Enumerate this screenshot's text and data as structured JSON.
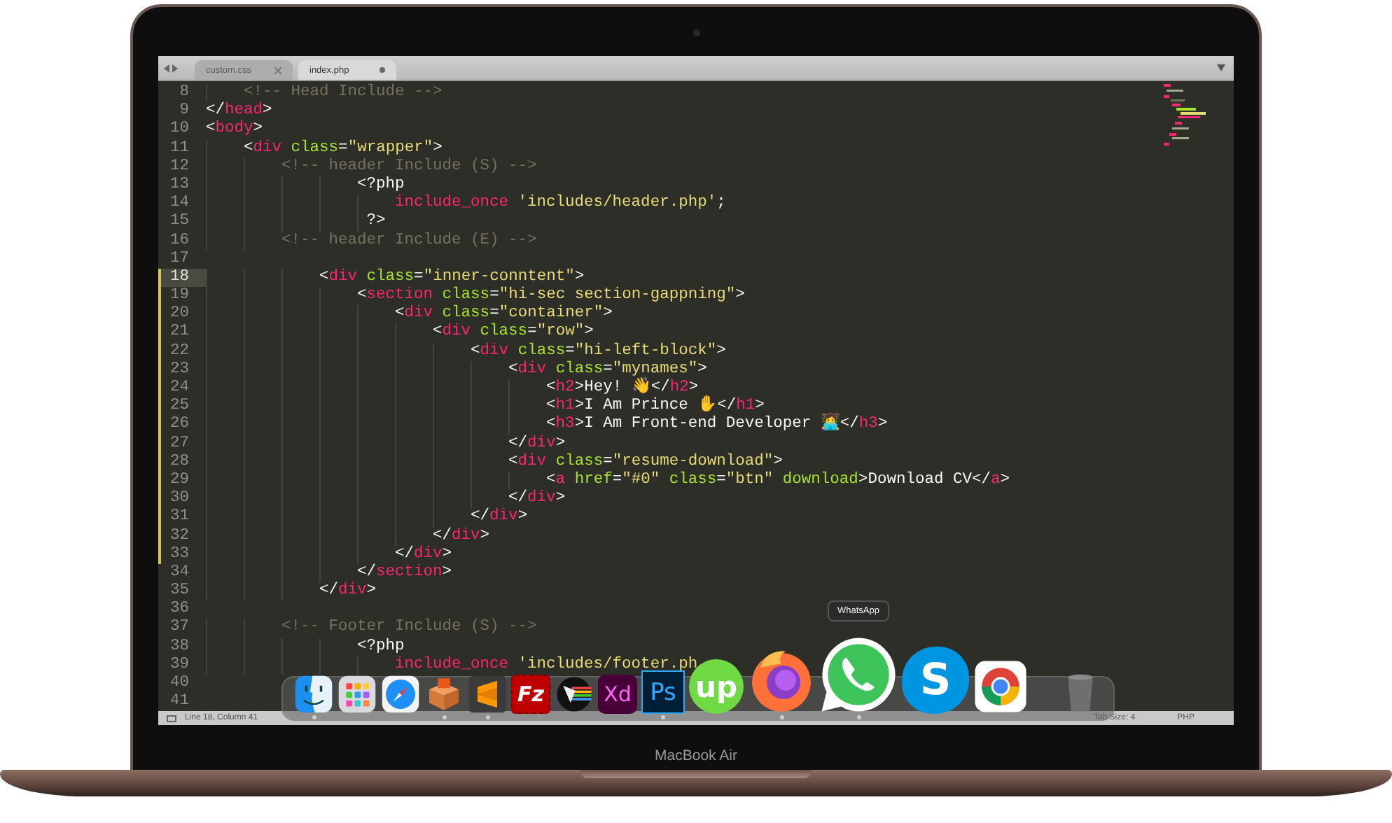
{
  "editor": {
    "tabs": [
      {
        "label": "custom.css",
        "selected": false,
        "modified": false
      },
      {
        "label": "index.php",
        "selected": true,
        "modified": true
      }
    ],
    "lines": [
      {
        "number": "8",
        "current": false,
        "changed": false,
        "tokens": [
          {
            "kind": "comment",
            "text": "    <!-- Head Include -->"
          }
        ]
      },
      {
        "number": "9",
        "current": false,
        "changed": false,
        "tokens": [
          {
            "kind": "punct",
            "text": "</"
          },
          {
            "kind": "tag",
            "text": "head"
          },
          {
            "kind": "punct",
            "text": ">"
          }
        ]
      },
      {
        "number": "10",
        "current": false,
        "changed": false,
        "tokens": [
          {
            "kind": "punct",
            "text": "<"
          },
          {
            "kind": "tag",
            "text": "body"
          },
          {
            "kind": "punct",
            "text": ">"
          }
        ]
      },
      {
        "number": "11",
        "current": false,
        "changed": false,
        "tokens": [
          {
            "kind": "punct",
            "text": "    <"
          },
          {
            "kind": "tag",
            "text": "div"
          },
          {
            "kind": "attr",
            "text": " class"
          },
          {
            "kind": "punct",
            "text": "="
          },
          {
            "kind": "string",
            "text": "\"wrapper\""
          },
          {
            "kind": "punct",
            "text": ">"
          }
        ]
      },
      {
        "number": "12",
        "current": false,
        "changed": false,
        "tokens": [
          {
            "kind": "comment",
            "text": "        <!-- header Include (S) -->"
          }
        ]
      },
      {
        "number": "13",
        "current": false,
        "changed": false,
        "tokens": [
          {
            "kind": "punct",
            "text": "                <?php"
          }
        ]
      },
      {
        "number": "14",
        "current": false,
        "changed": false,
        "tokens": [
          {
            "kind": "keyword",
            "text": "                    include_once"
          },
          {
            "kind": "string",
            "text": " 'includes/header.php'"
          },
          {
            "kind": "punct",
            "text": ";"
          }
        ]
      },
      {
        "number": "15",
        "current": false,
        "changed": false,
        "tokens": [
          {
            "kind": "punct",
            "text": "                 ?>"
          }
        ]
      },
      {
        "number": "16",
        "current": false,
        "changed": false,
        "tokens": [
          {
            "kind": "comment",
            "text": "        <!-- header Include (E) -->"
          }
        ]
      },
      {
        "number": "17",
        "current": false,
        "changed": false
      },
      {
        "number": "18",
        "current": true,
        "changed": true,
        "tokens": [
          {
            "kind": "punct",
            "text": "            <"
          },
          {
            "kind": "tag",
            "text": "div"
          },
          {
            "kind": "attr",
            "text": " class"
          },
          {
            "kind": "punct",
            "text": "="
          },
          {
            "kind": "string",
            "text": "\"inner-conntent\""
          },
          {
            "kind": "punct",
            "text": ">"
          }
        ]
      },
      {
        "number": "19",
        "current": false,
        "changed": true,
        "tokens": [
          {
            "kind": "punct",
            "text": "                <"
          },
          {
            "kind": "tag",
            "text": "section"
          },
          {
            "kind": "attr",
            "text": " class"
          },
          {
            "kind": "punct",
            "text": "="
          },
          {
            "kind": "string",
            "text": "\"hi-sec section-gappning\""
          },
          {
            "kind": "punct",
            "text": ">"
          }
        ]
      },
      {
        "number": "20",
        "current": false,
        "changed": true,
        "tokens": [
          {
            "kind": "punct",
            "text": "                    <"
          },
          {
            "kind": "tag",
            "text": "div"
          },
          {
            "kind": "attr",
            "text": " class"
          },
          {
            "kind": "punct",
            "text": "="
          },
          {
            "kind": "string",
            "text": "\"container\""
          },
          {
            "kind": "punct",
            "text": ">"
          }
        ]
      },
      {
        "number": "21",
        "current": false,
        "changed": true,
        "tokens": [
          {
            "kind": "punct",
            "text": "                        <"
          },
          {
            "kind": "tag",
            "text": "div"
          },
          {
            "kind": "attr",
            "text": " class"
          },
          {
            "kind": "punct",
            "text": "="
          },
          {
            "kind": "string",
            "text": "\"row\""
          },
          {
            "kind": "punct",
            "text": ">"
          }
        ]
      },
      {
        "number": "22",
        "current": false,
        "changed": true,
        "tokens": [
          {
            "kind": "punct",
            "text": "                            <"
          },
          {
            "kind": "tag",
            "text": "div"
          },
          {
            "kind": "attr",
            "text": " class"
          },
          {
            "kind": "punct",
            "text": "="
          },
          {
            "kind": "string",
            "text": "\"hi-left-block\""
          },
          {
            "kind": "punct",
            "text": ">"
          }
        ]
      },
      {
        "number": "23",
        "current": false,
        "changed": true,
        "tokens": [
          {
            "kind": "punct",
            "text": "                                <"
          },
          {
            "kind": "tag",
            "text": "div"
          },
          {
            "kind": "attr",
            "text": " class"
          },
          {
            "kind": "punct",
            "text": "="
          },
          {
            "kind": "string",
            "text": "\"mynames\""
          },
          {
            "kind": "punct",
            "text": ">"
          }
        ]
      },
      {
        "number": "24",
        "current": false,
        "changed": true,
        "tokens": [
          {
            "kind": "punct",
            "text": "                                    <"
          },
          {
            "kind": "tag",
            "text": "h2"
          },
          {
            "kind": "punct",
            "text": ">"
          },
          {
            "kind": "plain",
            "text": "Hey! 👋"
          },
          {
            "kind": "punct",
            "text": "</"
          },
          {
            "kind": "tag",
            "text": "h2"
          },
          {
            "kind": "punct",
            "text": ">"
          }
        ]
      },
      {
        "number": "25",
        "current": false,
        "changed": true,
        "tokens": [
          {
            "kind": "punct",
            "text": "                                    <"
          },
          {
            "kind": "tag",
            "text": "h1"
          },
          {
            "kind": "punct",
            "text": ">"
          },
          {
            "kind": "plain",
            "text": "I Am Prince ✋"
          },
          {
            "kind": "punct",
            "text": "</"
          },
          {
            "kind": "tag",
            "text": "h1"
          },
          {
            "kind": "punct",
            "text": ">"
          }
        ]
      },
      {
        "number": "26",
        "current": false,
        "changed": true,
        "tokens": [
          {
            "kind": "punct",
            "text": "                                    <"
          },
          {
            "kind": "tag",
            "text": "h3"
          },
          {
            "kind": "punct",
            "text": ">"
          },
          {
            "kind": "plain",
            "text": "I Am Front-end Developer 👩‍💻"
          },
          {
            "kind": "punct",
            "text": "</"
          },
          {
            "kind": "tag",
            "text": "h3"
          },
          {
            "kind": "punct",
            "text": ">"
          }
        ]
      },
      {
        "number": "27",
        "current": false,
        "changed": true,
        "tokens": [
          {
            "kind": "punct",
            "text": "                                </"
          },
          {
            "kind": "tag",
            "text": "div"
          },
          {
            "kind": "punct",
            "text": ">"
          }
        ]
      },
      {
        "number": "28",
        "current": false,
        "changed": true,
        "tokens": [
          {
            "kind": "punct",
            "text": "                                <"
          },
          {
            "kind": "tag",
            "text": "div"
          },
          {
            "kind": "attr",
            "text": " class"
          },
          {
            "kind": "punct",
            "text": "="
          },
          {
            "kind": "string",
            "text": "\"resume-download\""
          },
          {
            "kind": "punct",
            "text": ">"
          }
        ]
      },
      {
        "number": "29",
        "current": false,
        "changed": true,
        "tokens": [
          {
            "kind": "punct",
            "text": "                                    <"
          },
          {
            "kind": "tag",
            "text": "a"
          },
          {
            "kind": "attr",
            "text": " href"
          },
          {
            "kind": "punct",
            "text": "="
          },
          {
            "kind": "string",
            "text": "\"#0\""
          },
          {
            "kind": "attr",
            "text": " class"
          },
          {
            "kind": "punct",
            "text": "="
          },
          {
            "kind": "string",
            "text": "\"btn\""
          },
          {
            "kind": "attr",
            "text": " download"
          },
          {
            "kind": "punct",
            "text": ">"
          },
          {
            "kind": "plain",
            "text": "Download CV"
          },
          {
            "kind": "punct",
            "text": "</"
          },
          {
            "kind": "tag",
            "text": "a"
          },
          {
            "kind": "punct",
            "text": ">"
          }
        ]
      },
      {
        "number": "30",
        "current": false,
        "changed": true,
        "tokens": [
          {
            "kind": "punct",
            "text": "                                </"
          },
          {
            "kind": "tag",
            "text": "div"
          },
          {
            "kind": "punct",
            "text": ">"
          }
        ]
      },
      {
        "number": "31",
        "current": false,
        "changed": true,
        "tokens": [
          {
            "kind": "punct",
            "text": "                            </"
          },
          {
            "kind": "tag",
            "text": "div"
          },
          {
            "kind": "punct",
            "text": ">"
          }
        ]
      },
      {
        "number": "32",
        "current": false,
        "changed": true,
        "tokens": [
          {
            "kind": "punct",
            "text": "                        </"
          },
          {
            "kind": "tag",
            "text": "div"
          },
          {
            "kind": "punct",
            "text": ">"
          }
        ]
      },
      {
        "number": "33",
        "current": false,
        "changed": true,
        "tokens": [
          {
            "kind": "punct",
            "text": "                    </"
          },
          {
            "kind": "tag",
            "text": "div"
          },
          {
            "kind": "punct",
            "text": ">"
          }
        ]
      },
      {
        "number": "34",
        "current": false,
        "changed": false,
        "tokens": [
          {
            "kind": "punct",
            "text": "                </"
          },
          {
            "kind": "tag",
            "text": "section"
          },
          {
            "kind": "punct",
            "text": ">"
          }
        ]
      },
      {
        "number": "35",
        "current": false,
        "changed": false,
        "tokens": [
          {
            "kind": "punct",
            "text": "            </"
          },
          {
            "kind": "tag",
            "text": "div"
          },
          {
            "kind": "punct",
            "text": ">"
          }
        ]
      },
      {
        "number": "36",
        "current": false,
        "changed": false
      },
      {
        "number": "37",
        "current": false,
        "changed": false,
        "tokens": [
          {
            "kind": "comment",
            "text": "        <!-- Footer Include (S) -->"
          }
        ]
      },
      {
        "number": "38",
        "current": false,
        "changed": false,
        "tokens": [
          {
            "kind": "punct",
            "text": "                <?php"
          }
        ]
      },
      {
        "number": "39",
        "current": false,
        "changed": false,
        "tokens": [
          {
            "kind": "keyword",
            "text": "                    include_once"
          },
          {
            "kind": "string",
            "text": " 'includes/footer.ph"
          }
        ]
      },
      {
        "number": "40",
        "current": false,
        "changed": false
      },
      {
        "number": "41",
        "current": false,
        "changed": false
      }
    ],
    "status_bar": {
      "position": "Line 18, Column 41",
      "tab_size": "Tab Size: 4",
      "syntax": "PHP"
    }
  },
  "dock": {
    "items": [
      {
        "kind": "finder",
        "running": true
      },
      {
        "kind": "launchpad",
        "running": false
      },
      {
        "kind": "safari",
        "running": false
      },
      {
        "kind": "box",
        "running": true
      },
      {
        "kind": "sublime",
        "running": true
      },
      {
        "kind": "fz",
        "label": "Fz",
        "running": false
      },
      {
        "kind": "pen",
        "running": false
      },
      {
        "kind": "xd",
        "label": "Xd",
        "running": false
      },
      {
        "kind": "ps",
        "label": "Ps",
        "running": true
      },
      {
        "kind": "up",
        "label": "up",
        "running": false
      },
      {
        "kind": "firefox",
        "running": true
      },
      {
        "kind": "whatsapp",
        "tooltip": "WhatsApp",
        "running": true
      },
      {
        "kind": "skype",
        "label": "S",
        "running": false
      },
      {
        "kind": "chrome",
        "running": false
      },
      {
        "kind": "trash",
        "running": false
      }
    ]
  },
  "device_label": "MacBook Air"
}
